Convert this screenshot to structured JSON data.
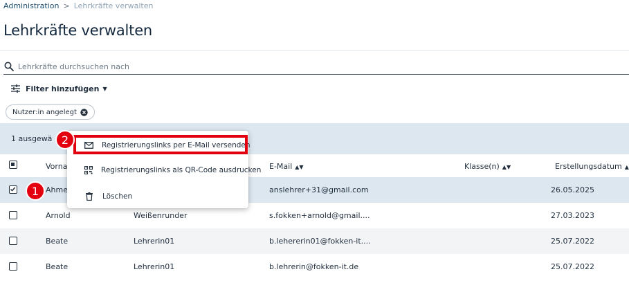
{
  "breadcrumb": {
    "root": "Administration",
    "separator": ">",
    "current": "Lehrkräfte verwalten"
  },
  "page": {
    "title": "Lehrkräfte verwalten"
  },
  "search": {
    "placeholder": "Lehrkräfte durchsuchen nach",
    "value": ""
  },
  "filter": {
    "label": "Filter hinzufügen"
  },
  "chip": {
    "label": "Nutzer:in angelegt"
  },
  "selection": {
    "label": "1 ausgewä"
  },
  "table": {
    "headers": {
      "vorname": "Vornam",
      "email": "E-Mail",
      "klassen": "Klasse(n)",
      "erstellungsdatum": "Erstellungsdatum"
    },
    "rows": [
      {
        "vorname": "Ahme",
        "nachname": "",
        "email": "anslehrer+31@gmail.com",
        "datum": "26.05.2025",
        "checked": true
      },
      {
        "vorname": "Arnold",
        "nachname": "Weißenrunder",
        "email": "s.fokken+arnold@gmail....",
        "datum": "27.03.2023",
        "checked": false
      },
      {
        "vorname": "Beate",
        "nachname": "Lehrerin01",
        "email": "b.lehererin01@fokken-it....",
        "datum": "25.07.2022",
        "checked": false
      },
      {
        "vorname": "Beate",
        "nachname": "Lehrerin01",
        "email": "b.lehrerin@fokken-it.de",
        "datum": "25.07.2022",
        "checked": false
      }
    ]
  },
  "menu": {
    "items": [
      {
        "label": "Registrierungslinks per E-Mail versenden",
        "icon": "mail-icon"
      },
      {
        "label": "Registrierungslinks als QR-Code ausdrucken",
        "icon": "qr-code-icon"
      },
      {
        "label": "Löschen",
        "icon": "trash-icon"
      }
    ]
  },
  "markers": {
    "one": "1",
    "two": "2"
  },
  "colors": {
    "accent": "#1d4f73",
    "selected_row": "#dde7f0",
    "annotation_red": "#e3000f"
  }
}
